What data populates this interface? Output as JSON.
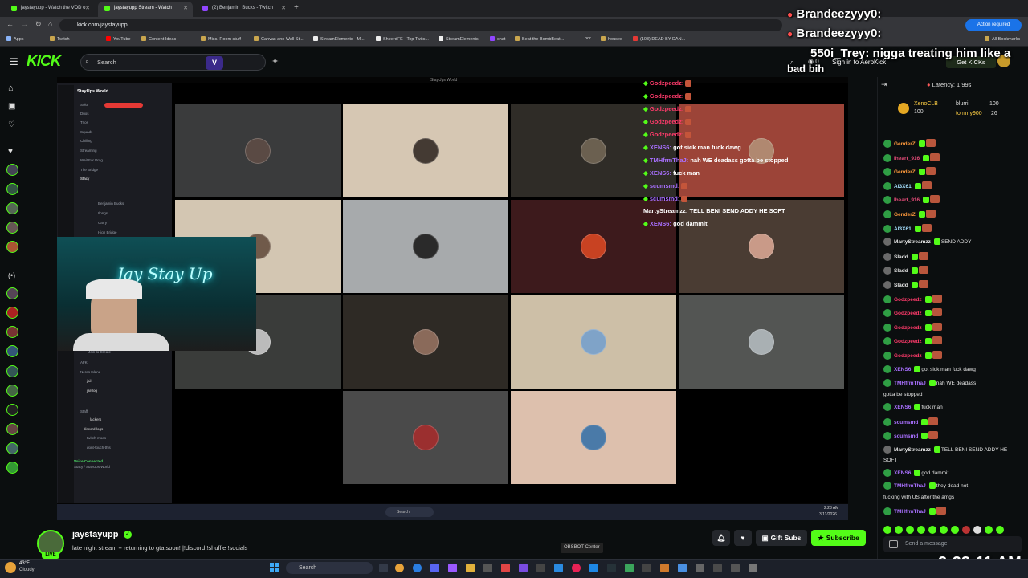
{
  "browser": {
    "tabs": [
      {
        "label": "jaystayupp - Watch the VOD o"
      },
      {
        "label": "jaystayupp Stream - Watch"
      },
      {
        "label": "(2) Benjamin_Bucks - Twitch"
      }
    ],
    "url": "kick.com/jaystayupp",
    "bookmarks": [
      "Apps",
      "Twitch",
      "YouTube",
      "Content Ideas",
      "Misc. Room stuff",
      "Canvas and Wall St...",
      "StreamElements - M...",
      "SheerdFE - Top Twitc...",
      "StreamElements -",
      "chat",
      "Beat the BombBeat...",
      "oor",
      "houses",
      "(103) DEAD BY DAN...",
      "All Bookmarks"
    ],
    "action_required": "Action required"
  },
  "kick": {
    "logo": "KICK",
    "search_placeholder": "Search",
    "sign_in": "Sign in to AeroKick",
    "get_kicks": "Get KICKs",
    "viewer_count": "0"
  },
  "alerts": [
    {
      "text": "Brandeezyyy0:"
    },
    {
      "text": "Brandeezyyy0:"
    },
    {
      "text": "550i_Trey: nigga treating him like a"
    },
    {
      "text": "bad bih"
    }
  ],
  "stream": {
    "discord": {
      "server": "StayUps World",
      "window_title": "StayUps World",
      "channels": [
        "Solo",
        "Duos",
        "Trios",
        "Squads",
        "Chilling",
        "Streaming",
        "Wait For Drag",
        "The Bridge",
        "Stacy"
      ],
      "members": [
        "Benjamin Bucks",
        "Ilongs",
        "Carry",
        "High Bridge"
      ],
      "lower_channels": [
        "Join to Create",
        "AFK",
        "Nerds Island",
        "jail",
        "jail-log",
        "Staff",
        "lackers",
        "discord-logs",
        "twitch-mods",
        "dont-touch-this"
      ],
      "voice_status": "Voice Connected",
      "voice_sub": "Stacy / StayUps World"
    },
    "webcam_sign": "Jay Stay Up",
    "overlay_chat": [
      {
        "user": "Godzpeedz:",
        "text": "",
        "color": "#ff3b6b"
      },
      {
        "user": "Godzpeedz:",
        "text": "",
        "color": "#ff3b6b"
      },
      {
        "user": "Godzpeedz:",
        "text": "",
        "color": "#ff3b6b"
      },
      {
        "user": "Godzpeedz:",
        "text": "",
        "color": "#ff3b6b"
      },
      {
        "user": "Godzpeedz:",
        "text": "",
        "color": "#ff3b6b"
      },
      {
        "user": "XENS6:",
        "text": "got sick man fuck dawg",
        "color": "#a970ff"
      },
      {
        "user": "TMHfrmThaJ:",
        "text": "nah WE deadass gotta be stopped",
        "color": "#a970ff"
      },
      {
        "user": "XENS6:",
        "text": "fuck man",
        "color": "#a970ff"
      },
      {
        "user": "scumsmd:",
        "text": "",
        "color": "#a970ff"
      },
      {
        "user": "scumsmd:",
        "text": "",
        "color": "#a970ff"
      },
      {
        "user": "MartyStreamzz:",
        "text": "TELL BENI SEND ADDY HE SOFT",
        "color": "#ffffff"
      },
      {
        "user": "XENS6:",
        "text": "god dammit",
        "color": "#a970ff"
      }
    ],
    "taskbar_search": "Search",
    "taskbar_time": "2:23 AM",
    "taskbar_date": "3/11/2026"
  },
  "chat": {
    "latency": "Latency: 1.99s",
    "top_gifters": [
      {
        "name": "XenoCLB",
        "amount": "100"
      },
      {
        "name": "blurri",
        "amount": "100"
      },
      {
        "name": "tommy900",
        "amount": "26"
      }
    ],
    "messages": [
      {
        "user": "GenderZ",
        "text": "",
        "color": "#ff9a3c"
      },
      {
        "user": "Iheart_916",
        "text": "",
        "color": "#e84d7a"
      },
      {
        "user": "GenderZ",
        "text": "",
        "color": "#ff9a3c"
      },
      {
        "user": "AI3X61",
        "text": "",
        "color": "#a6e0ff"
      },
      {
        "user": "Iheart_916",
        "text": "",
        "color": "#e84d7a"
      },
      {
        "user": "GenderZ",
        "text": "",
        "color": "#ff9a3c"
      },
      {
        "user": "AI3X61",
        "text": "",
        "color": "#a6e0ff"
      },
      {
        "user": "MartyStreamzz",
        "text": "SEND ADDY",
        "color": "#e6e6e6"
      },
      {
        "user": "Sladd",
        "text": "",
        "color": "#e6e6e6"
      },
      {
        "user": "Sladd",
        "text": "",
        "color": "#e6e6e6"
      },
      {
        "user": "Sladd",
        "text": "",
        "color": "#e6e6e6"
      },
      {
        "user": "Godzpeedz",
        "text": "",
        "color": "#ff3b6b"
      },
      {
        "user": "Godzpeedz",
        "text": "",
        "color": "#ff3b6b"
      },
      {
        "user": "Godzpeedz",
        "text": "",
        "color": "#ff3b6b"
      },
      {
        "user": "Godzpeedz",
        "text": "",
        "color": "#ff3b6b"
      },
      {
        "user": "Godzpeedz",
        "text": "",
        "color": "#ff3b6b"
      },
      {
        "user": "XENS6",
        "text": "got sick man fuck dawg",
        "color": "#a970ff"
      },
      {
        "user": "TMHfrmThaJ",
        "text": "nah WE deadass",
        "color": "#a970ff"
      }
    ],
    "wrap1": "gotta be stopped",
    "messages2": [
      {
        "user": "XENS6",
        "text": "fuck man",
        "color": "#a970ff"
      },
      {
        "user": "scumsmd",
        "text": "",
        "color": "#a970ff"
      },
      {
        "user": "scumsmd",
        "text": "",
        "color": "#a970ff"
      },
      {
        "user": "MartyStreamzz",
        "text": "TELL BENI SEND ADDY HE",
        "color": "#e6e6e6"
      }
    ],
    "wrap2": "SOFT",
    "messages3": [
      {
        "user": "XENS6",
        "text": "god dammit",
        "color": "#a970ff"
      },
      {
        "user": "TMHfrmThaJ",
        "text": "they dead not",
        "color": "#a970ff"
      }
    ],
    "wrap3": "fucking with US after the amgs",
    "messages4": [
      {
        "user": "TMHfrmThaJ",
        "text": "",
        "color": "#a970ff"
      }
    ],
    "input_placeholder": "Send a message",
    "clock": "2:23:11 AM"
  },
  "channel": {
    "name": "jaystayupp",
    "title": "late night stream + returning to gta soon!  |!discord !shuffle !socials",
    "live": "LIVE",
    "gift_subs": "Gift Subs",
    "subscribe": "Subscribe",
    "obsbot": "OBSBOT Center"
  },
  "windows": {
    "weather_temp": "43°F",
    "weather_desc": "Cloudy",
    "search": "Search"
  }
}
